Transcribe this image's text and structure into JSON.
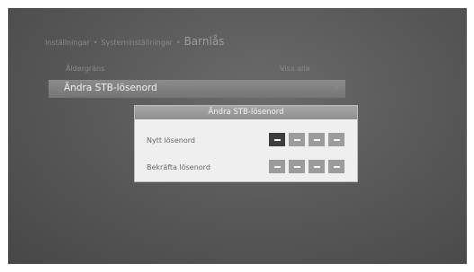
{
  "breadcrumb": {
    "items": [
      "Inställningar",
      "Systeminställningar"
    ],
    "separator": "•",
    "current": "Barnlås"
  },
  "menu": {
    "header_label": "Åldergräns",
    "header_value": "Visa alla",
    "selected_item": "Ändra STB-lösenord",
    "selected_arrow": "›"
  },
  "dialog": {
    "title": "Ändra STB-lösenord",
    "fields": [
      {
        "label": "Nytt lösenord",
        "digits": 4,
        "active_digit": 1
      },
      {
        "label": "Bekräfta lösenord",
        "digits": 4,
        "active_digit": null
      }
    ]
  },
  "colors": {
    "background": "#5a5a5a",
    "pin_active": "#3d3d3d",
    "pin_inactive": "#9c9c9c",
    "dialog_bg": "#efefef"
  }
}
